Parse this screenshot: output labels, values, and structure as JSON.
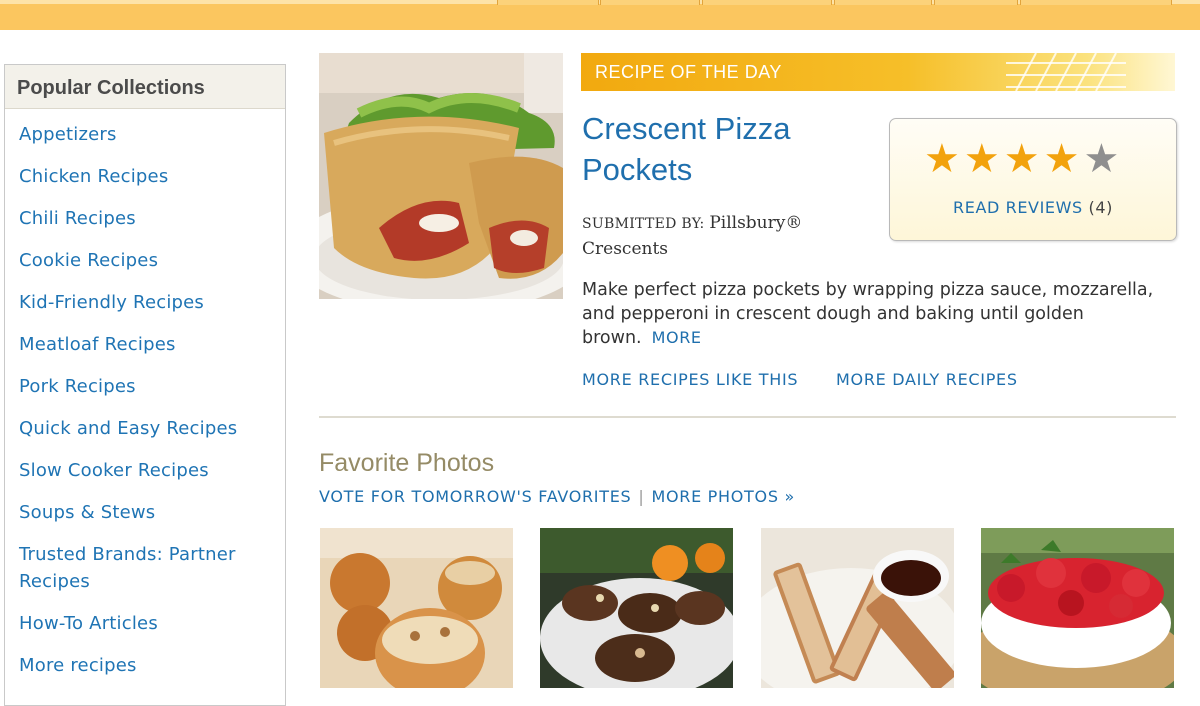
{
  "sidebar": {
    "title": "Popular Collections",
    "items": [
      {
        "label": "Appetizers"
      },
      {
        "label": "Chicken Recipes"
      },
      {
        "label": "Chili Recipes"
      },
      {
        "label": "Cookie Recipes"
      },
      {
        "label": "Kid-Friendly Recipes"
      },
      {
        "label": "Meatloaf Recipes"
      },
      {
        "label": "Pork Recipes"
      },
      {
        "label": "Quick and Easy Recipes"
      },
      {
        "label": "Slow Cooker Recipes"
      },
      {
        "label": "Soups & Stews"
      },
      {
        "label": "Trusted Brands: Partner",
        "label2": "Recipes"
      },
      {
        "label": "How-To Articles"
      },
      {
        "label": "More recipes"
      }
    ]
  },
  "recipe": {
    "banner": "RECIPE OF THE DAY",
    "title_line1": "Crescent Pizza",
    "title_line2": "Pockets",
    "submitted_label": "SUBMITTED BY:",
    "submitted_by_1": "Pillsbury®",
    "submitted_by_2": "Crescents",
    "rating": 4,
    "rating_max": 5,
    "reviews_label": "READ REVIEWS",
    "reviews_count": "(4)",
    "description": "Make perfect pizza pockets by wrapping pizza sauce, mozzarella, and pepperoni in crescent dough and baking until golden brown.",
    "more_label": "MORE",
    "link_more_like": "MORE RECIPES LIKE THIS",
    "link_more_daily": "MORE DAILY RECIPES"
  },
  "favorites": {
    "title": "Favorite Photos",
    "vote_label": "VOTE FOR TOMORROW'S FAVORITES",
    "separator": "|",
    "more_photos_label": "MORE PHOTOS »"
  },
  "colors": {
    "accent_orange": "#fbc65f",
    "link_blue": "#1f74b4",
    "star_gold": "#f2a20d"
  },
  "icons": [
    "star-icon",
    "waffle-grid-icon"
  ]
}
